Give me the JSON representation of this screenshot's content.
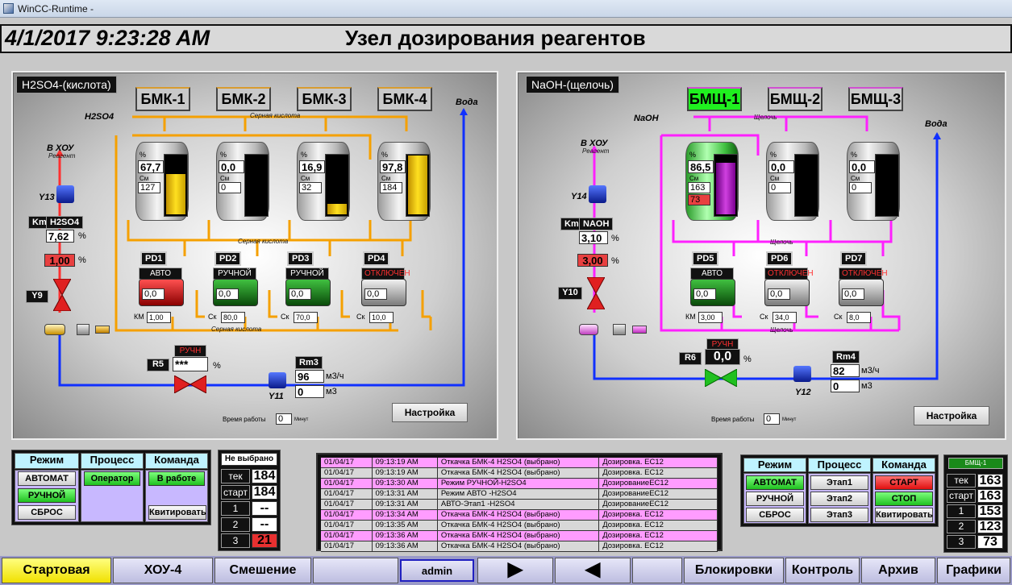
{
  "window_title": "WinCC-Runtime -",
  "datetime": "4/1/2017 9:23:28 AM",
  "page_title": "Узел дозирования реагентов",
  "left": {
    "title": "H2SO4-(кислота)",
    "tanks": [
      {
        "name": "БМК-1",
        "pct": "67,7",
        "cm": "127",
        "fill": 0.68,
        "pctsym": "%",
        "cmsym": "См"
      },
      {
        "name": "БМК-2",
        "pct": "0,0",
        "cm": "0",
        "fill": 0.0,
        "pctsym": "%",
        "cmsym": "См"
      },
      {
        "name": "БМК-3",
        "pct": "16,9",
        "cm": "32",
        "fill": 0.17,
        "pctsym": "%",
        "cmsym": "См"
      },
      {
        "name": "БМК-4",
        "pct": "97,8",
        "cm": "184",
        "fill": 0.98,
        "pctsym": "%",
        "cmsym": "См"
      }
    ],
    "reagent_label": "H2SO4",
    "acid_line": "Серная кислота",
    "water_label": "Вода",
    "to_xou": "В ХОУ",
    "reagent_small": "Реагент",
    "valve_y13": "Y13",
    "km_label": "Km",
    "km_name": "H2SO4",
    "km_value": "7,62",
    "km_unit": "%",
    "km_set": "1,00",
    "km_set_unit": "%",
    "y9": "Y9",
    "pumps": [
      {
        "name": "PD1",
        "mode": "АВТО",
        "val": "0,0",
        "unit": "КМ",
        "extra": "1,00",
        "color": "red",
        "mode_red": false
      },
      {
        "name": "PD2",
        "mode": "РУЧНОЙ",
        "val": "0,0",
        "unit": "Ск",
        "extra": "80,0",
        "color": "green",
        "mode_red": false
      },
      {
        "name": "PD3",
        "mode": "РУЧНОЙ",
        "val": "0,0",
        "unit": "Ск",
        "extra": "70,0",
        "color": "green",
        "mode_red": false
      },
      {
        "name": "PD4",
        "mode": "ОТКЛЮЧЕН",
        "val": "0,0",
        "unit": "Ск",
        "extra": "10,0",
        "color": "grey",
        "mode_red": true
      }
    ],
    "r5": "R5",
    "r5_mode": "РУЧН",
    "r5_value": "***",
    "r5_unit": "%",
    "rm": "Rm3",
    "rm_flow": "96",
    "rm_flow_unit": "м3/ч",
    "rm_total": "0",
    "rm_total_unit": "м3",
    "y11": "Y11",
    "worktime_label": "Время работы",
    "worktime_value": "0",
    "worktime_unit": "Минут",
    "settings_btn": "Настройка"
  },
  "right": {
    "title": "NaOH-(щелочь)",
    "tanks": [
      {
        "name": "БМЩ-1",
        "pct": "86,5",
        "cm": "163",
        "cm2": "73",
        "fill": 0.87,
        "pctsym": "%",
        "cmsym": "См"
      },
      {
        "name": "БМЩ-2",
        "pct": "0,0",
        "cm": "0",
        "fill": 0.0,
        "pctsym": "%",
        "cmsym": "См"
      },
      {
        "name": "БМЩ-3",
        "pct": "0,0",
        "cm": "0",
        "fill": 0.0,
        "pctsym": "%",
        "cmsym": "См"
      }
    ],
    "reagent_label": "NaOH",
    "alkali_line": "Щелочь",
    "water_label": "Вода",
    "to_xou": "В ХОУ",
    "reagent_small": "Реагент",
    "valve_y14": "Y14",
    "km_label": "Km",
    "km_name": "NAOH",
    "km_value": "3,10",
    "km_unit": "%",
    "km_set": "3,00",
    "km_set_unit": "%",
    "y10": "Y10",
    "pumps": [
      {
        "name": "PD5",
        "mode": "АВТО",
        "val": "0,0",
        "unit": "КМ",
        "extra": "3,00",
        "color": "green",
        "mode_red": false
      },
      {
        "name": "PD6",
        "mode": "ОТКЛЮЧЕН",
        "val": "0,0",
        "unit": "Ск",
        "extra": "34,0",
        "color": "grey",
        "mode_red": true
      },
      {
        "name": "PD7",
        "mode": "ОТКЛЮЧЕН",
        "val": "0,0",
        "unit": "Ск",
        "extra": "8,0",
        "color": "grey",
        "mode_red": true
      }
    ],
    "r6": "R6",
    "r6_mode": "РУЧН",
    "r6_value": "0,0",
    "r6_unit": "%",
    "rm": "Rm4",
    "rm_flow": "82",
    "rm_flow_unit": "м3/ч",
    "rm_total": "0",
    "rm_total_unit": "м3",
    "y12": "Y12",
    "worktime_label": "Время работы",
    "worktime_value": "0",
    "worktime_unit": "Минут",
    "settings_btn": "Настройка"
  },
  "left_ctrl": {
    "headers": [
      "Режим",
      "Процесс",
      "Команда"
    ],
    "mode_buttons": [
      "АВТОМАТ",
      "РУЧНОЙ",
      "СБРОС"
    ],
    "process_buttons": [
      "Оператор"
    ],
    "command_buttons": [
      "В работе",
      "Квитировать"
    ]
  },
  "left_counter": {
    "selected": "Не выбрано",
    "rows": [
      {
        "label": "тек",
        "value": "184"
      },
      {
        "label": "старт",
        "value": "184"
      },
      {
        "label": "1",
        "value": "--"
      },
      {
        "label": "2",
        "value": "--"
      },
      {
        "label": "3",
        "value": "21"
      }
    ]
  },
  "events": [
    {
      "date": "01/04/17",
      "time": "09:13:19 AM",
      "msg": "Откачка БМК-4 H2SO4 (выбрано)",
      "src": "Дозировка. ЕС12",
      "hl": true
    },
    {
      "date": "01/04/17",
      "time": "09:13:19 AM",
      "msg": "Откачка БМК-4 H2SO4 (выбрано)",
      "src": "Дозировка. ЕС12",
      "hl": false
    },
    {
      "date": "01/04/17",
      "time": "09:13:30 AM",
      "msg": "Режим РУЧНОЙ-H2SO4",
      "src": "ДозированиеЕС12",
      "hl": true
    },
    {
      "date": "01/04/17",
      "time": "09:13:31 AM",
      "msg": "Режим АВТО -H2SO4",
      "src": "ДозированиеЕС12",
      "hl": false
    },
    {
      "date": "01/04/17",
      "time": "09:13:31 AM",
      "msg": "АВТО-Этап1 -H2SO4",
      "src": "ДозированиеЕС12",
      "hl": false
    },
    {
      "date": "01/04/17",
      "time": "09:13:34 AM",
      "msg": "Откачка БМК-4 H2SO4 (выбрано)",
      "src": "Дозировка. ЕС12",
      "hl": true
    },
    {
      "date": "01/04/17",
      "time": "09:13:35 AM",
      "msg": "Откачка БМК-4 H2SO4 (выбрано)",
      "src": "Дозировка. ЕС12",
      "hl": false
    },
    {
      "date": "01/04/17",
      "time": "09:13:36 AM",
      "msg": "Откачка БМК-4 H2SO4 (выбрано)",
      "src": "Дозировка. ЕС12",
      "hl": true
    },
    {
      "date": "01/04/17",
      "time": "09:13:36 AM",
      "msg": "Откачка БМК-4 H2SO4 (выбрано)",
      "src": "Дозировка. ЕС12",
      "hl": false
    }
  ],
  "right_ctrl": {
    "headers": [
      "Режим",
      "Процесс",
      "Команда"
    ],
    "mode_buttons": [
      "АВТОМАТ",
      "РУЧНОЙ",
      "СБРОС"
    ],
    "process_buttons": [
      "Этап1",
      "Этап2",
      "Этап3"
    ],
    "command_buttons": [
      "СТАРТ",
      "СТОП",
      "Квитировать"
    ]
  },
  "right_counter": {
    "selected": "БМЩ-1",
    "rows": [
      {
        "label": "тек",
        "value": "163"
      },
      {
        "label": "старт",
        "value": "163"
      },
      {
        "label": "1",
        "value": "153"
      },
      {
        "label": "2",
        "value": "123"
      },
      {
        "label": "3",
        "value": "73"
      }
    ]
  },
  "nav": {
    "start": "Стартовая",
    "xou4": "ХОУ-4",
    "mix": "Смешение",
    "user": "admin",
    "blocks": "Блокировки",
    "control": "Контроль",
    "archive": "Архив",
    "graphs": "Графики"
  },
  "colors": {
    "acid": "#f5a000",
    "alkali": "#ff20ff",
    "water": "#1030ff",
    "event_hl": "#ff9cff"
  }
}
